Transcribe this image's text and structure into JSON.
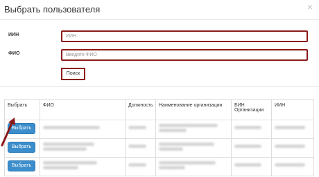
{
  "dialog": {
    "title": "Выбрать пользователя",
    "close_icon": "close-icon"
  },
  "form": {
    "iin_label": "ИИН",
    "iin_placeholder": "ИИН",
    "fio_label": "ФИО",
    "fio_placeholder": "Введите ФИО",
    "search_label": "Поиск",
    "highlight_color": "#8b1a1a"
  },
  "table": {
    "headers": [
      "Выбрать",
      "ФИО",
      "Должность",
      "Наименование организации",
      "БИН Организации",
      "ИИН"
    ],
    "select_label": "Выбрать",
    "select_color": "#3c8dcb",
    "row_count_visible": 3,
    "cell_text_redacted": true
  }
}
